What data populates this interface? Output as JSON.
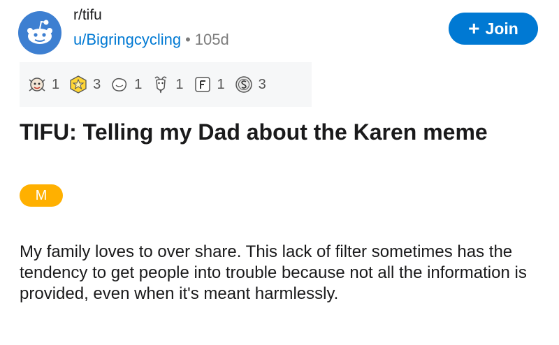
{
  "subreddit": {
    "name": "r/tifu",
    "icon": "reddit-alien-icon",
    "color": "#3d7fd1"
  },
  "post_meta": {
    "author": "u/Bigringcycling",
    "separator": "•",
    "age": "105d"
  },
  "join_button": {
    "icon": "plus-icon",
    "label": "Join",
    "color": "#0079d3"
  },
  "awards": [
    {
      "icon": "wholesome-award-icon",
      "count": "1"
    },
    {
      "icon": "gold-star-award-icon",
      "count": "3"
    },
    {
      "icon": "hugz-award-icon",
      "count": "1"
    },
    {
      "icon": "goat-award-icon",
      "count": "1"
    },
    {
      "icon": "press-f-award-icon",
      "count": "1"
    },
    {
      "icon": "silver-coin-award-icon",
      "count": "3"
    }
  ],
  "post": {
    "title": "TIFU: Telling my Dad about the Karen meme",
    "flair": "M",
    "flair_color": "#ffb000",
    "body": "My family loves to over share. This lack of filter sometimes has the tendency to get people into trouble because not all the information is provided, even when it's meant harmlessly."
  }
}
